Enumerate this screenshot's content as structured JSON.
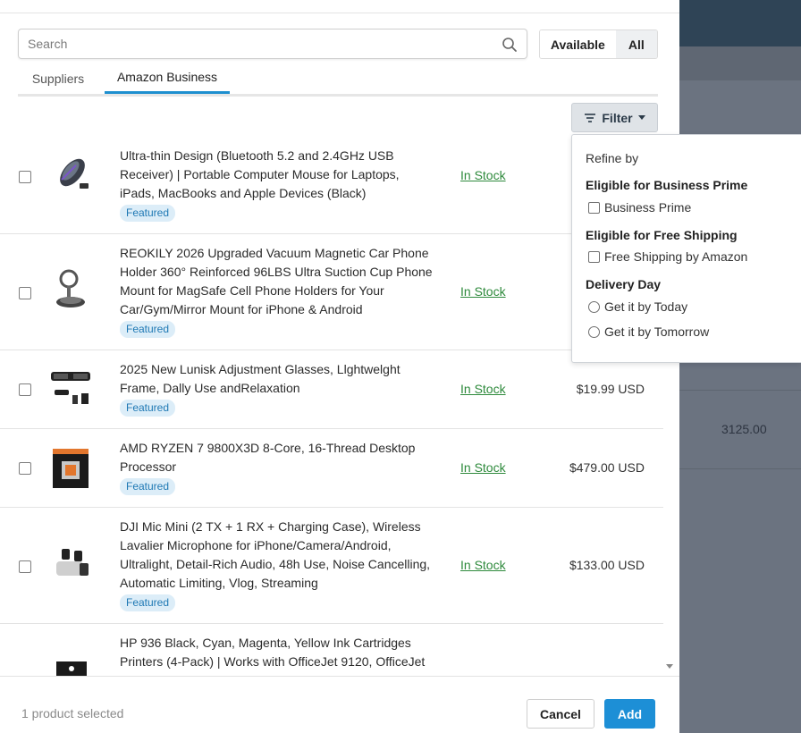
{
  "background": {
    "value": "3125.00"
  },
  "search": {
    "placeholder": "Search"
  },
  "availability_toggle": {
    "available_label": "Available",
    "all_label": "All"
  },
  "tabs": [
    {
      "label": "Suppliers"
    },
    {
      "label": "Amazon Business",
      "active": true
    }
  ],
  "filter": {
    "label": "Filter"
  },
  "products": [
    {
      "title": "Ultra-thin Design (Bluetooth 5.2 and 2.4GHz USB Receiver) | Portable Computer Mouse for Laptops, iPads, MacBooks and Apple Devices (Black)",
      "badge": "Featured",
      "stock": "In Stock",
      "price": ""
    },
    {
      "title": "REOKILY 2026 Upgraded Vacuum Magnetic Car Phone Holder 360° Reinforced 96LBS Ultra Suction Cup Phone Mount for MagSafe Cell Phone Holders for Your Car/Gym/Mirror Mount for iPhone & Android",
      "badge": "Featured",
      "stock": "In Stock",
      "price": ""
    },
    {
      "title": "2025 New Lunisk Adjustment Glasses, Llghtwelght Frame, Dally Use andRelaxation",
      "badge": "Featured",
      "stock": "In Stock",
      "price": "$19.99 USD"
    },
    {
      "title": "AMD RYZEN 7 9800X3D 8-Core, 16-Thread Desktop Processor",
      "badge": "Featured",
      "stock": "In Stock",
      "price": "$479.00 USD"
    },
    {
      "title": "DJI Mic Mini (2 TX + 1 RX + Charging Case), Wireless Lavalier Microphone for iPhone/Camera/Android, Ultralight, Detail-Rich Audio, 48h Use, Noise Cancelling, Automatic Limiting, Vlog, Streaming",
      "badge": "Featured",
      "stock": "In Stock",
      "price": "$133.00 USD"
    },
    {
      "title": "HP 936 Black, Cyan, Magenta, Yellow Ink Cartridges Printers (4-Pack) | Works with OfficeJet 9120, OfficeJet",
      "badge": "",
      "stock": "",
      "price": ""
    }
  ],
  "footer": {
    "selected_text": "1 product selected",
    "cancel_label": "Cancel",
    "add_label": "Add"
  },
  "dropdown": {
    "refine_label": "Refine by",
    "sections": [
      {
        "heading": "Eligible for Business Prime",
        "options": [
          {
            "label": "Business Prime",
            "type": "checkbox"
          }
        ]
      },
      {
        "heading": "Eligible for Free Shipping",
        "options": [
          {
            "label": "Free Shipping by Amazon",
            "type": "checkbox"
          }
        ]
      },
      {
        "heading": "Delivery Day",
        "options": [
          {
            "label": "Get it by Today",
            "type": "radio"
          },
          {
            "label": "Get it by Tomorrow",
            "type": "radio"
          }
        ]
      }
    ]
  },
  "colors": {
    "accent": "#1d8fd6",
    "stock_green": "#2e8a3c",
    "badge_bg": "#dcedf8",
    "badge_text": "#1e78b4"
  }
}
